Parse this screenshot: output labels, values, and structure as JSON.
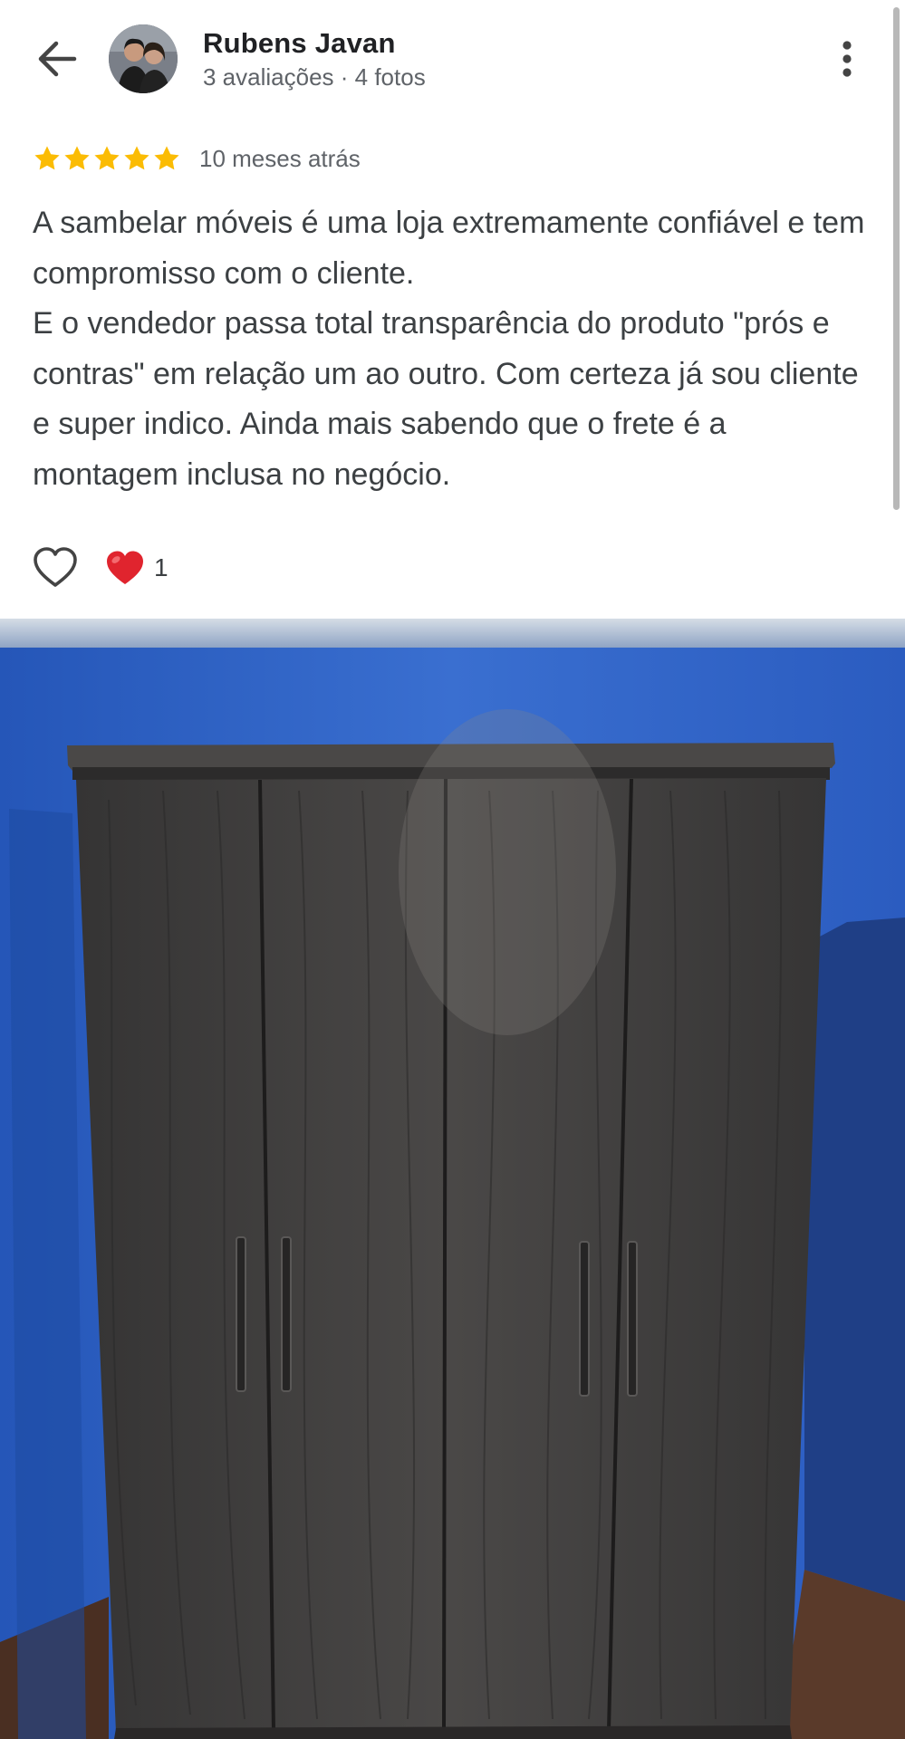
{
  "header": {
    "reviewer_name": "Rubens Javan",
    "reviewer_meta": "3 avaliações · 4 fotos",
    "back_icon": "arrow-back-icon",
    "more_icon": "more-vert-icon"
  },
  "review": {
    "rating": 5,
    "rating_max": 5,
    "time": "10 meses atrás",
    "text": "A sambelar móveis é uma loja extremamente confiável e tem compromisso com o cliente.\nE o vendedor passa total transparência do produto \"prós e contras\" em relação um ao outro. Com certeza já sou cliente e super indico. Ainda mais sabendo que o frete é a montagem inclusa no negócio."
  },
  "reactions": {
    "like_icon": "heart-outline-icon",
    "reaction_icon": "red-heart-icon",
    "count": "1"
  },
  "colors": {
    "star": "#fbbc04",
    "heart": "#e0242e",
    "wall": "#2f63c8",
    "wardrobe": "#3d3b3b"
  }
}
